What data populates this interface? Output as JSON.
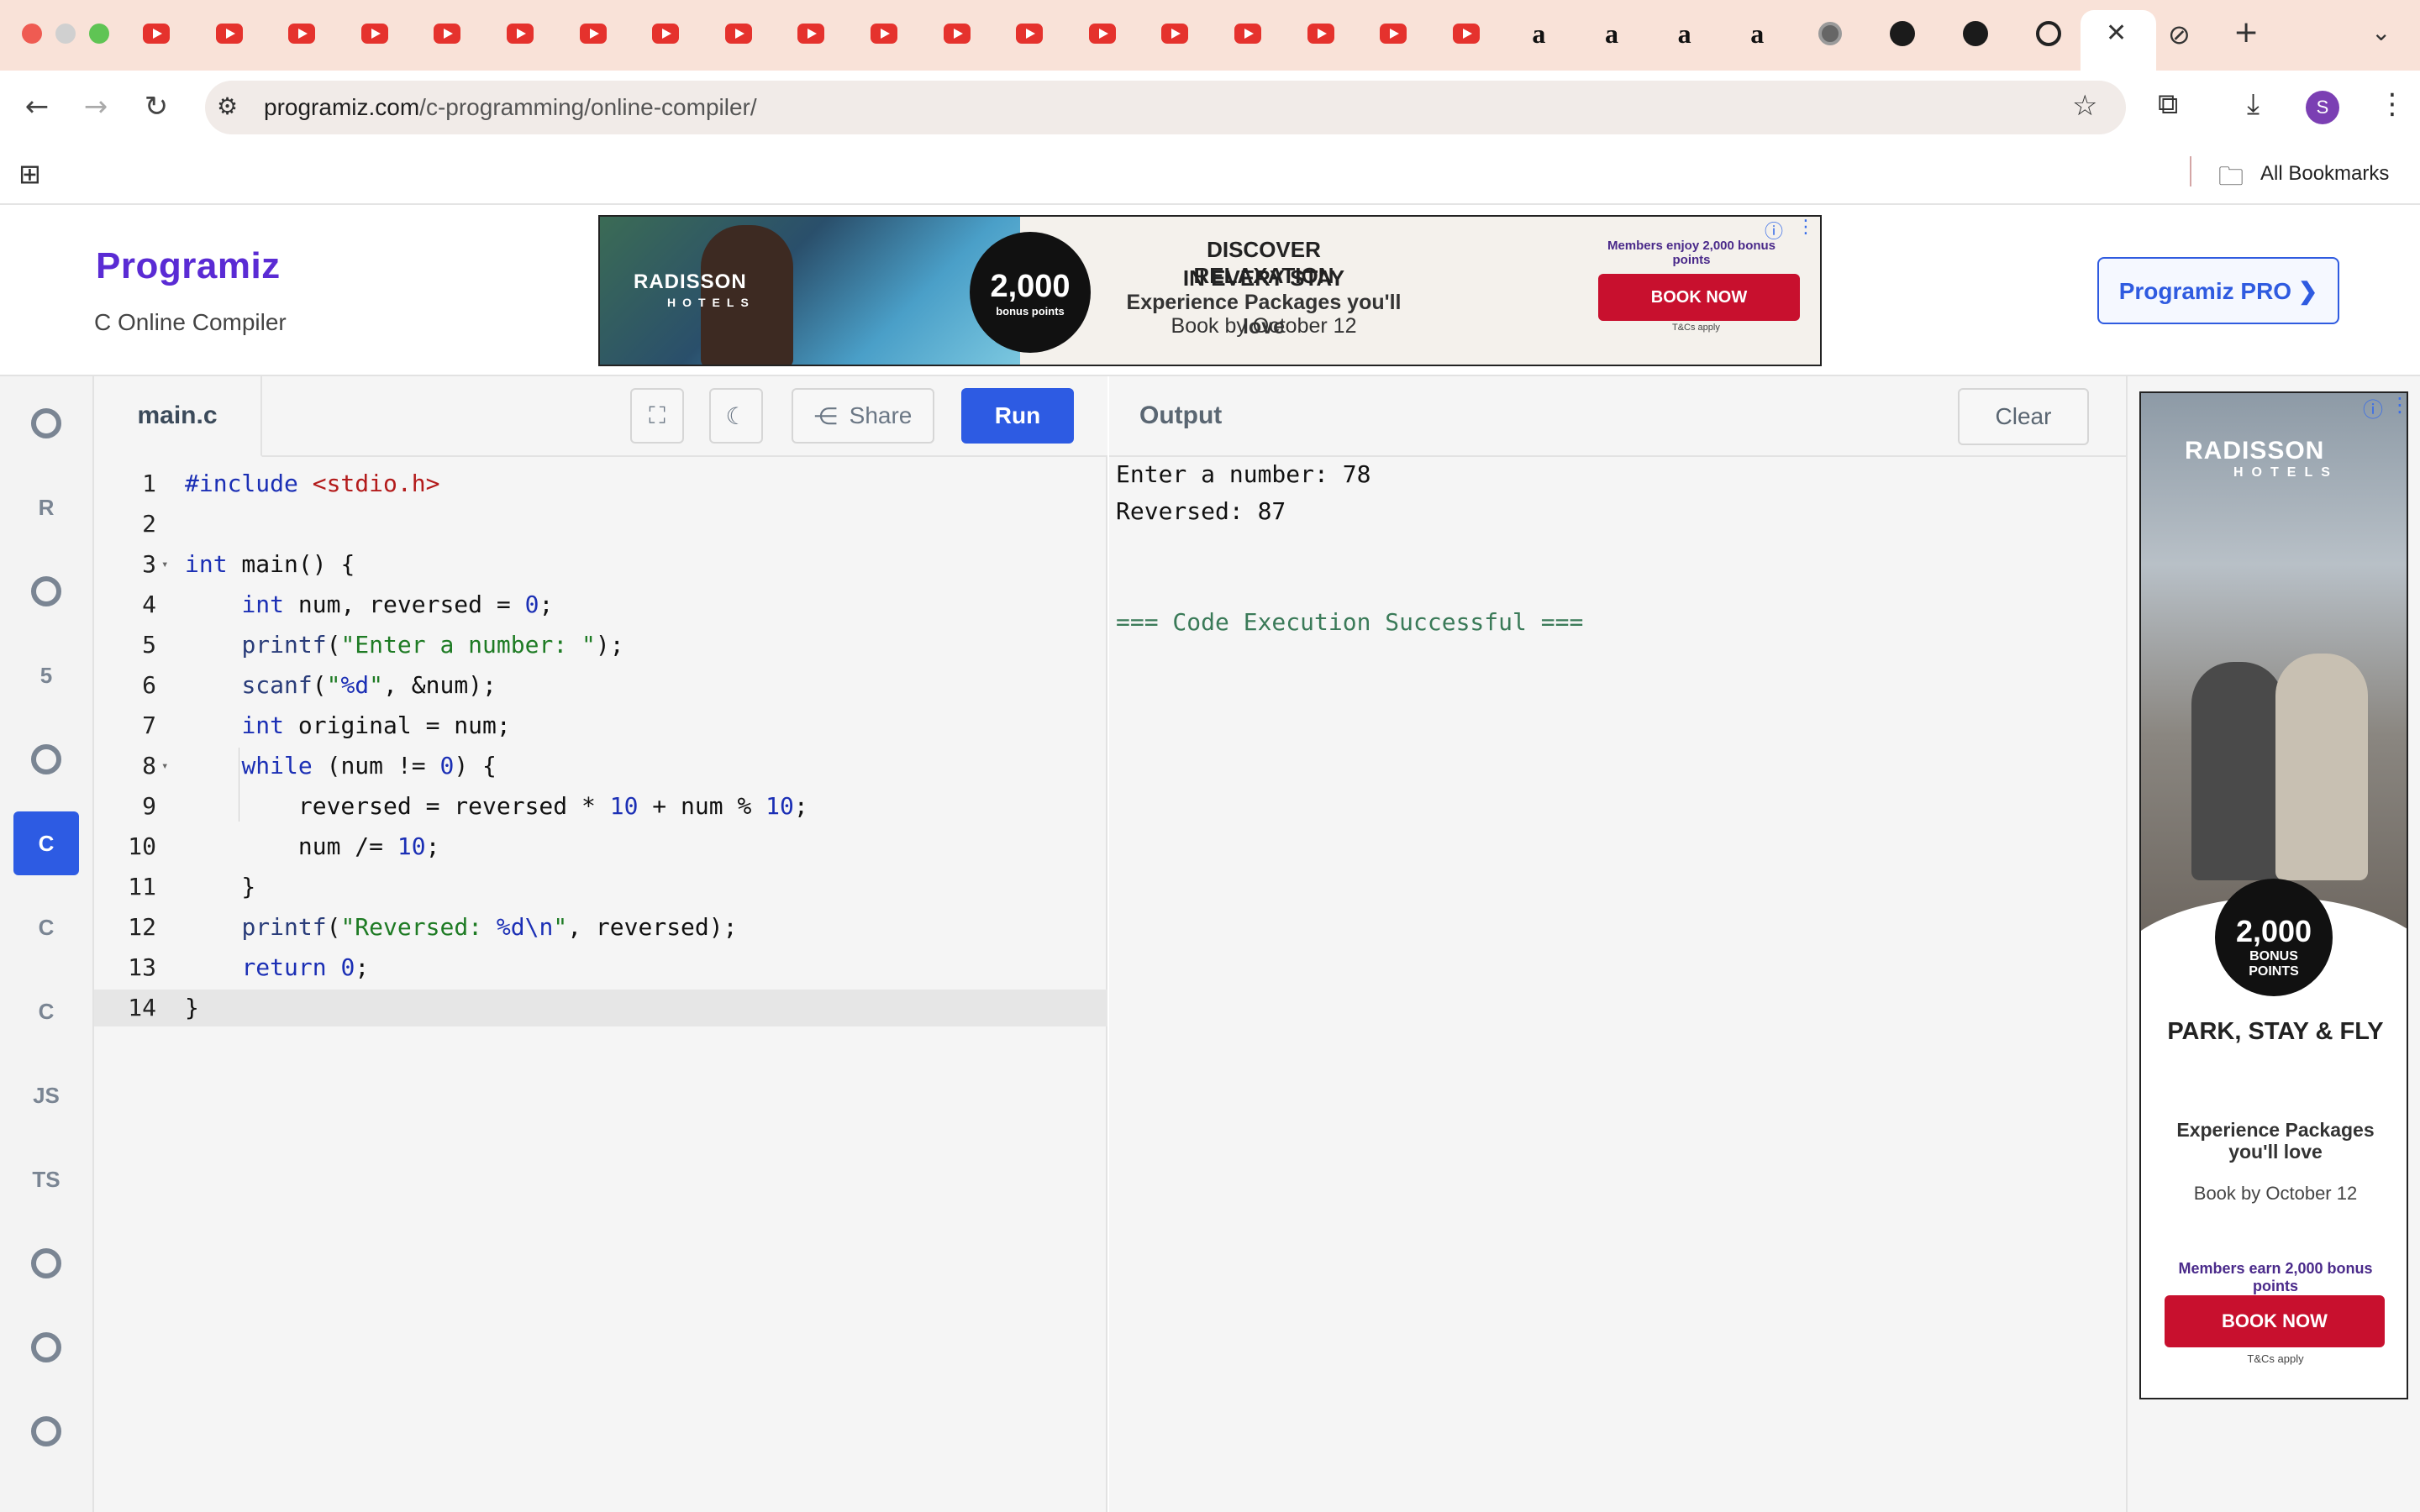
{
  "browser": {
    "url_domain": "programiz.com",
    "url_path": "/c-programming/online-compiler/",
    "bookmarks_label": "All Bookmarks",
    "profile_initial": "S",
    "tabs": [
      {
        "icon": "youtube-icon"
      },
      {
        "icon": "youtube-icon"
      },
      {
        "icon": "youtube-icon"
      },
      {
        "icon": "youtube-icon"
      },
      {
        "icon": "youtube-icon"
      },
      {
        "icon": "youtube-icon"
      },
      {
        "icon": "youtube-icon"
      },
      {
        "icon": "youtube-icon"
      },
      {
        "icon": "youtube-icon"
      },
      {
        "icon": "youtube-icon"
      },
      {
        "icon": "youtube-icon"
      },
      {
        "icon": "youtube-icon"
      },
      {
        "icon": "youtube-icon"
      },
      {
        "icon": "youtube-icon"
      },
      {
        "icon": "youtube-icon"
      },
      {
        "icon": "youtube-icon"
      },
      {
        "icon": "youtube-icon"
      },
      {
        "icon": "youtube-icon"
      },
      {
        "icon": "youtube-icon"
      },
      {
        "icon": "amazon-icon",
        "text": "a"
      },
      {
        "icon": "amazon-icon",
        "text": "a"
      },
      {
        "icon": "amazon-icon",
        "text": "a"
      },
      {
        "icon": "amazon-icon",
        "text": "a"
      },
      {
        "icon": "globe-icon"
      },
      {
        "icon": "github-icon"
      },
      {
        "icon": "github-icon"
      },
      {
        "icon": "chatgpt-icon"
      }
    ]
  },
  "header": {
    "logo": "Programiz",
    "subtitle": "C Online Compiler",
    "pro_button": "Programiz PRO ❯"
  },
  "ad_banner": {
    "brand": "RADISSON",
    "brand_sub": "HOTELS",
    "points": "2,000",
    "points_label": "bonus points",
    "headline1": "DISCOVER RELAXATION",
    "headline2": "IN EVERY STAY",
    "line3": "Experience Packages you'll love",
    "line4": "Book by October 12",
    "members": "Members enjoy 2,000 bonus points",
    "cta": "BOOK NOW",
    "terms": "T&Cs apply"
  },
  "rail": {
    "items": [
      {
        "name": "python",
        "text": ""
      },
      {
        "name": "r",
        "text": "R"
      },
      {
        "name": "sql",
        "text": ""
      },
      {
        "name": "html",
        "text": "5"
      },
      {
        "name": "java",
        "text": ""
      },
      {
        "name": "c",
        "text": "C"
      },
      {
        "name": "cpp",
        "text": "C"
      },
      {
        "name": "csharp",
        "text": "C"
      },
      {
        "name": "js",
        "text": "JS"
      },
      {
        "name": "ts",
        "text": "TS"
      },
      {
        "name": "go",
        "text": ""
      },
      {
        "name": "swift",
        "text": ""
      },
      {
        "name": "rust",
        "text": ""
      }
    ]
  },
  "editor": {
    "file_tab": "main.c",
    "share": "Share",
    "run": "Run",
    "lines": [
      {
        "n": "1",
        "code": "#include <stdio.h>"
      },
      {
        "n": "2",
        "code": ""
      },
      {
        "n": "3",
        "code": "int main() {"
      },
      {
        "n": "4",
        "code": "    int num, reversed = 0;"
      },
      {
        "n": "5",
        "code": "    printf(\"Enter a number: \");"
      },
      {
        "n": "6",
        "code": "    scanf(\"%d\", &num);"
      },
      {
        "n": "7",
        "code": "    int original = num;"
      },
      {
        "n": "8",
        "code": "    while (num != 0) {"
      },
      {
        "n": "9",
        "code": "        reversed = reversed * 10 + num % 10;"
      },
      {
        "n": "10",
        "code": "        num /= 10;"
      },
      {
        "n": "11",
        "code": "    }"
      },
      {
        "n": "12",
        "code": "    printf(\"Reversed: %d\\n\", reversed);"
      },
      {
        "n": "13",
        "code": "    return 0;"
      },
      {
        "n": "14",
        "code": "}"
      }
    ]
  },
  "output": {
    "title": "Output",
    "clear": "Clear",
    "lines": [
      "Enter a number: 78",
      "Reversed: 87",
      "",
      "",
      "=== Code Execution Successful ==="
    ]
  },
  "side_ad": {
    "brand": "RADISSON",
    "brand_sub": "HOTELS",
    "points": "2,000",
    "points_label1": "BONUS",
    "points_label2": "POINTS",
    "headline": "PARK, STAY & FLY",
    "line1": "Experience Packages",
    "line2": "you'll love",
    "line3": "Book by October 12",
    "members": "Members earn 2,000 bonus points",
    "cta": "BOOK NOW",
    "terms": "T&Cs apply"
  }
}
